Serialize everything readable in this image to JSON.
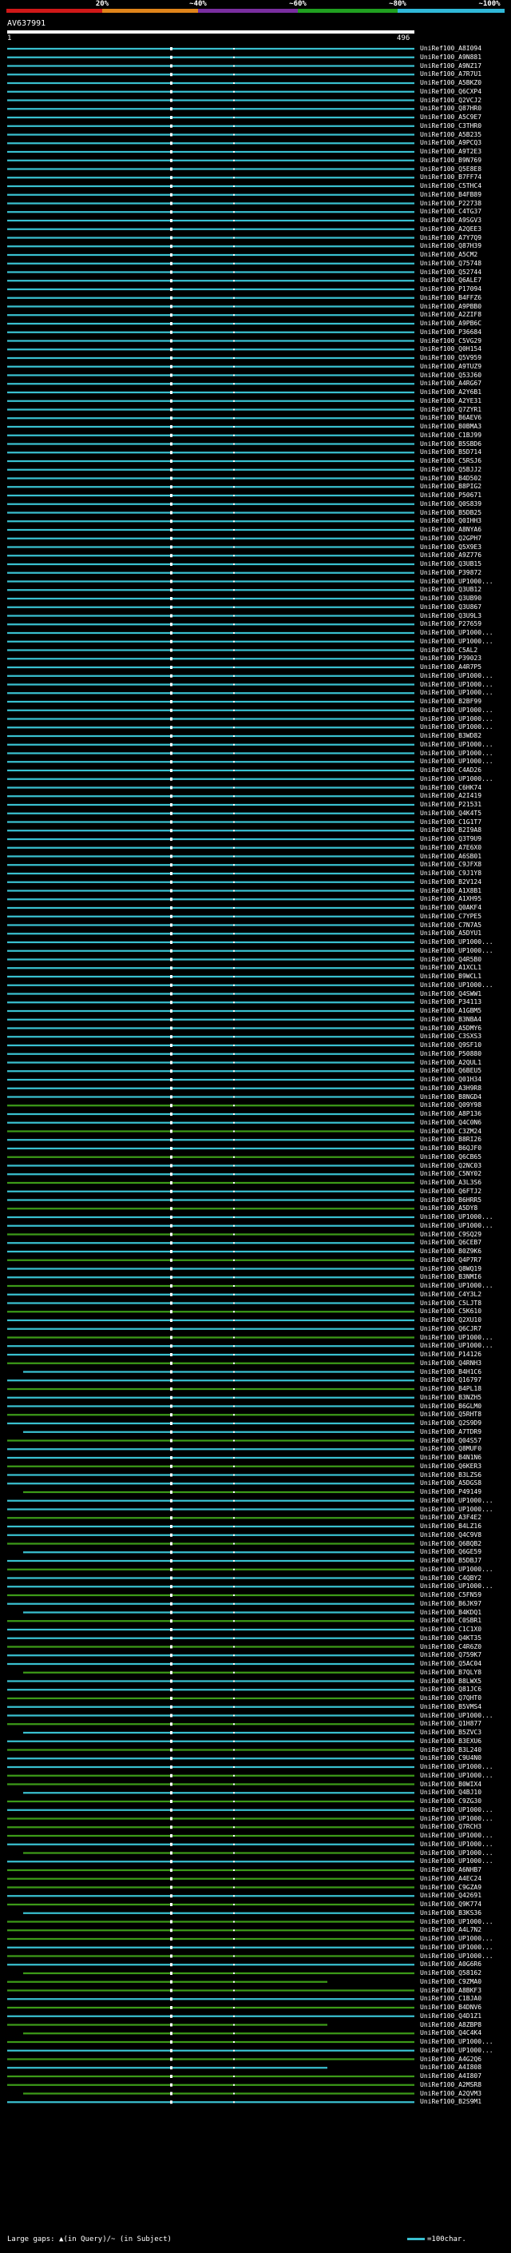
{
  "scale": {
    "labels": [
      "20%",
      "~40%",
      "~60%",
      "~80%",
      "~100%"
    ],
    "colors": [
      "#d01818",
      "#e0841a",
      "#7a2ea0",
      "#20a020",
      "#30b8d8"
    ]
  },
  "query": {
    "title": "AV637991",
    "start": "1",
    "end": "496"
  },
  "colors": {
    "identity_high": "#39c0d0",
    "identity_mid": "#3c9a18",
    "marker": "#ffffff",
    "background": "#000000"
  },
  "hits": [
    "UniRef100_A8I094",
    "UniRef100_A9N881",
    "UniRef100_A9NZ17",
    "UniRef100_A7R7U1",
    "UniRef100_A5BKZ0",
    "UniRef100_Q6CXP4",
    "UniRef100_Q2VCJ2",
    "UniRef100_Q87HR0",
    "UniRef100_A5C9E7",
    "UniRef100_C3THR0",
    "UniRef100_A5B235",
    "UniRef100_A9PCQ3",
    "UniRef100_A9T2E3",
    "UniRef100_B9N769",
    "UniRef100_Q5E8E8",
    "UniRef100_B7FF74",
    "UniRef100_C5THC4",
    "UniRef100_B4FB89",
    "UniRef100_P22738",
    "UniRef100_C4TG37",
    "UniRef100_A9SGV3",
    "UniRef100_A2QEE3",
    "UniRef100_A7Y7Q9",
    "UniRef100_Q87H39",
    "UniRef100_A5CM2",
    "UniRef100_Q75748",
    "UniRef100_Q52744",
    "UniRef100_Q6ALE7",
    "UniRef100_P17094",
    "UniRef100_B4FFZ6",
    "UniRef100_A9PBB0",
    "UniRef100_A2ZIF8",
    "UniRef100_A9PB6C",
    "UniRef100_P36684",
    "UniRef100_C5VG29",
    "UniRef100_Q0H154",
    "UniRef100_Q5V959",
    "UniRef100_A9TUZ9",
    "UniRef100_Q53J60",
    "UniRef100_A4RG67",
    "UniRef100_A2Y6B1",
    "UniRef100_A2YE31",
    "UniRef100_Q7ZYR1",
    "UniRef100_B6AEV6",
    "UniRef100_B0BMA3",
    "UniRef100_C1BJ99",
    "UniRef100_B5SBD6",
    "UniRef100_B5D714",
    "UniRef100_C5RSJ6",
    "UniRef100_Q5BJJ2",
    "UniRef100_B4D502",
    "UniRef100_B8PIG2",
    "UniRef100_P50671",
    "UniRef100_Q0S839",
    "UniRef100_B5DB25",
    "UniRef100_Q0IHH3",
    "UniRef100_A8NYA6",
    "UniRef100_Q2GPH7",
    "UniRef100_Q5X9E3",
    "UniRef100_A9Z776",
    "UniRef100_Q3UB15",
    "UniRef100_P39872",
    "UniRef100_UP1000...",
    "UniRef100_Q3UB12",
    "UniRef100_Q3UB90",
    "UniRef100_Q3U867",
    "UniRef100_Q3U9L3",
    "UniRef100_P27659",
    "UniRef100_UP1000...",
    "UniRef100_UP1000...",
    "UniRef100_C5AL2",
    "UniRef100_P39023",
    "UniRef100_A4R7P5",
    "UniRef100_UP1000...",
    "UniRef100_UP1000...",
    "UniRef100_UP1000...",
    "UniRef100_B2BF99",
    "UniRef100_UP1000...",
    "UniRef100_UP1000...",
    "UniRef100_UP1000...",
    "UniRef100_B3WD82",
    "UniRef100_UP1000...",
    "UniRef100_UP1000...",
    "UniRef100_UP1000...",
    "UniRef100_C4AD26",
    "UniRef100_UP1000...",
    "UniRef100_C6HK74",
    "UniRef100_A2I419",
    "UniRef100_P21531",
    "UniRef100_Q4K4T5",
    "UniRef100_C1G1T7",
    "UniRef100_B2I9A8",
    "UniRef100_Q3T9U9",
    "UniRef100_A7E6X0",
    "UniRef100_A6SB01",
    "UniRef100_C9JFX8",
    "UniRef100_C9J1Y8",
    "UniRef100_B2V124",
    "UniRef100_A1X8B1",
    "UniRef100_A1XH95",
    "UniRef100_Q0AKF4",
    "UniRef100_C7YPE5",
    "UniRef100_C7N7A5",
    "UniRef100_A5DYU1",
    "UniRef100_UP1000...",
    "UniRef100_UP1000...",
    "UniRef100_Q4R5B0",
    "UniRef100_A1XCL1",
    "UniRef100_B9WCL1",
    "UniRef100_UP1000...",
    "UniRef100_Q4SWW1",
    "UniRef100_P34113",
    "UniRef100_A1GBM5",
    "UniRef100_B3NBA4",
    "UniRef100_A5DMY6",
    "UniRef100_C3SXS3",
    "UniRef100_Q9SF10",
    "UniRef100_P50880",
    "UniRef100_A2QUL1",
    "UniRef100_Q6BEU5",
    "UniRef100_Q01H34",
    "UniRef100_A3H9R8",
    "UniRef100_B8NGD4",
    "UniRef100_Q09Y98",
    "UniRef100_A8P136",
    "UniRef100_Q4C0N6",
    "UniRef100_C3ZM24",
    "UniRef100_B8RI26",
    "UniRef100_B6QJF0",
    "UniRef100_Q6CB65",
    "UniRef100_Q2NC03",
    "UniRef100_C5NY02",
    "UniRef100_A3L3S6",
    "UniRef100_Q6FTJ2",
    "UniRef100_B6HRR5",
    "UniRef100_A5DY8",
    "UniRef100_UP1000...",
    "UniRef100_UP1000...",
    "UniRef100_C9SQ29",
    "UniRef100_Q6CEB7",
    "UniRef100_B0Z9K6",
    "UniRef100_Q4P7R7",
    "UniRef100_Q8WQ19",
    "UniRef100_B3NMI6",
    "UniRef100_UP1000...",
    "UniRef100_C4Y3L2",
    "UniRef100_C5LJT8",
    "UniRef100_C5K610",
    "UniRef100_Q2XU10",
    "UniRef100_Q6CJR7",
    "UniRef100_UP1000...",
    "UniRef100_UP1000...",
    "UniRef100_P14126",
    "UniRef100_Q4RNH3",
    "UniRef100_B4H1C6",
    "UniRef100_Q16797",
    "UniRef100_B4PL18",
    "UniRef100_B3NZH5",
    "UniRef100_B6GLM0",
    "UniRef100_Q5RHT8",
    "UniRef100_Q2S9D9",
    "UniRef100_A7TDR9",
    "UniRef100_Q04S57",
    "UniRef100_Q8MUF0",
    "UniRef100_B4N1N6",
    "UniRef100_Q6KER3",
    "UniRef100_B3LZS6",
    "UniRef100_A5DGS8",
    "UniRef100_P49149",
    "UniRef100_UP1000...",
    "UniRef100_UP1000...",
    "UniRef100_A3F4E2",
    "UniRef100_B4LZ16",
    "UniRef100_Q4C9V8",
    "UniRef100_Q6BQB2",
    "UniRef100_Q6GE59",
    "UniRef100_B5DBJ7",
    "UniRef100_UP1000...",
    "UniRef100_C4QBY2",
    "UniRef100_UP1000...",
    "UniRef100_C5FN59",
    "UniRef100_B6JK97",
    "UniRef100_B4KDQ1",
    "UniRef100_C0SBR1",
    "UniRef100_C1C1X0",
    "UniRef100_Q4KT35",
    "UniRef100_C4R6Z0",
    "UniRef100_Q759K7",
    "UniRef100_Q5AC04",
    "UniRef100_B7QLY8",
    "UniRef100_B8LWX5",
    "UniRef100_Q81JC6",
    "UniRef100_Q7QHT0",
    "UniRef100_B5VMS4",
    "UniRef100_UP1000...",
    "UniRef100_Q1H877",
    "UniRef100_B5ZVC3",
    "UniRef100_B3EXU6",
    "UniRef100_B3L240",
    "UniRef100_C9U4N0",
    "UniRef100_UP1000...",
    "UniRef100_UP1000...",
    "UniRef100_B0WIX4",
    "UniRef100_Q4BJ10",
    "UniRef100_C9ZG30",
    "UniRef100_UP1000...",
    "UniRef100_UP1000...",
    "UniRef100_Q7RCH3",
    "UniRef100_UP1000...",
    "UniRef100_UP1000...",
    "UniRef100_UP1000...",
    "UniRef100_UP1000...",
    "UniRef100_A6NHB7",
    "UniRef100_A4EC24",
    "UniRef100_C9GZA9",
    "UniRef100_Q42691",
    "UniRef100_Q9K774",
    "UniRef100_B3KS36",
    "UniRef100_UP1000...",
    "UniRef100_A4L7N2",
    "UniRef100_UP1000...",
    "UniRef100_UP1000...",
    "UniRef100_UP1000...",
    "UniRef100_A0G6R6",
    "UniRef100_Q58162",
    "UniRef100_C9ZMA0",
    "UniRef100_A8BKF3",
    "UniRef100_C1BJA0",
    "UniRef100_B4DNV6",
    "UniRef100_Q4D1Z1",
    "UniRef100_A8ZBP8",
    "UniRef100_Q4C4K4",
    "UniRef100_UP1000...",
    "UniRef100_UP1000...",
    "UniRef100_A4G2Q6",
    "UniRef100_A4I808",
    "UniRef100_A4I807",
    "UniRef100_A2MSR8",
    "UniRef100_A2QVM3",
    "UniRef100_B2S9M1"
  ],
  "footer": {
    "text": "Large gaps: ▲(in Query)/~ (in Subject)"
  },
  "legend": {
    "text": "=100char."
  }
}
